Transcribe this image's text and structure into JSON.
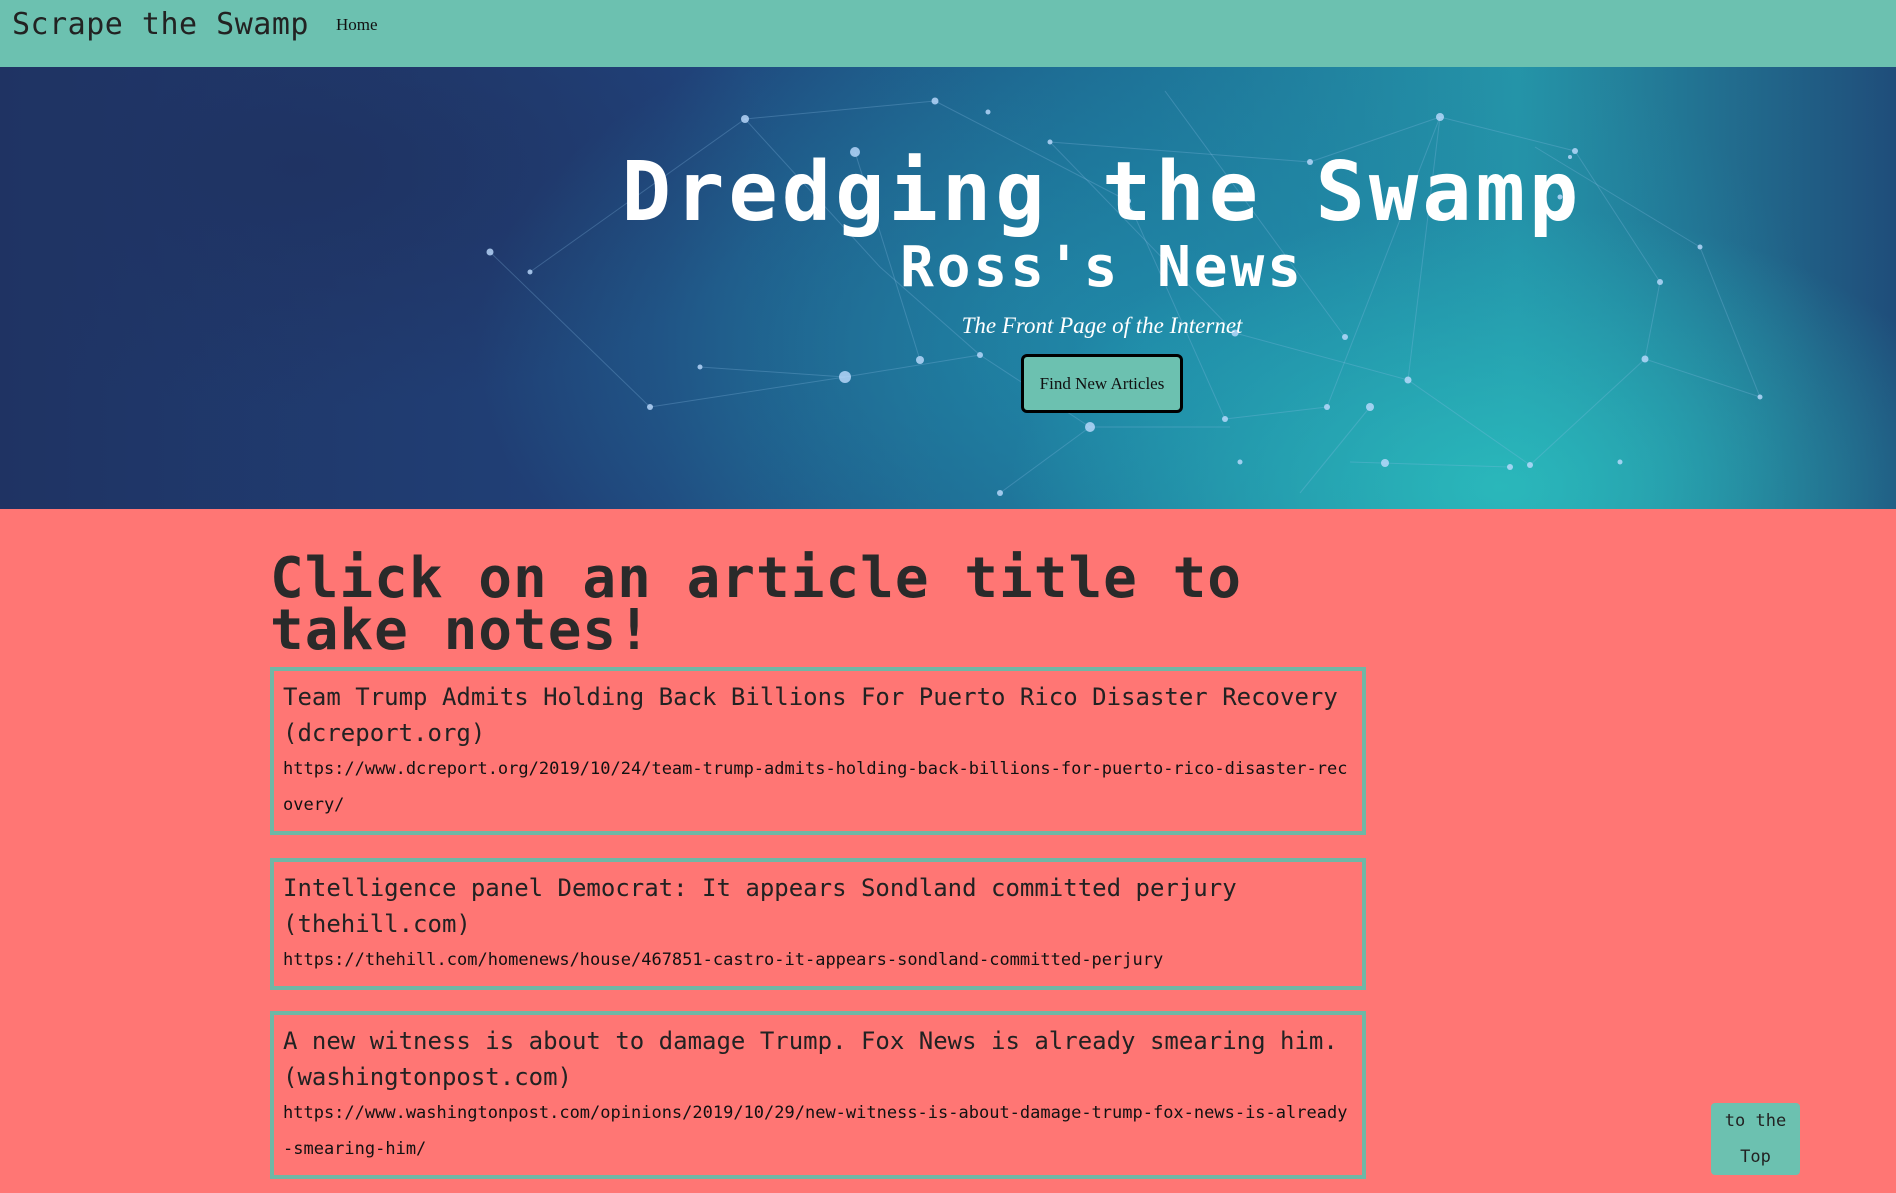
{
  "navbar": {
    "brand": "Scrape the Swamp",
    "home_label": "Home"
  },
  "hero": {
    "title": "Dredging the Swamp",
    "subtitle": "Ross's News",
    "tagline": "The Front Page of the Internet",
    "button_label": "Find New Articles"
  },
  "main": {
    "heading": "Click on an article title to take notes!",
    "articles": [
      {
        "title": "Team Trump Admits Holding Back Billions For Puerto Rico Disaster Recovery (dcreport.org)",
        "url": "https://www.dcreport.org/2019/10/24/team-trump-admits-holding-back-billions-for-puerto-rico-disaster-recovery/"
      },
      {
        "title": "Intelligence panel Democrat: It appears Sondland committed perjury (thehill.com)",
        "url": "https://thehill.com/homenews/house/467851-castro-it-appears-sondland-committed-perjury"
      },
      {
        "title": "A new witness is about to damage Trump. Fox News is already smearing him. (washingtonpost.com)",
        "url": "https://www.washingtonpost.com/opinions/2019/10/29/new-witness-is-about-damage-trump-fox-news-is-already-smearing-him/"
      }
    ]
  },
  "to_top_label": "to the Top",
  "colors": {
    "navbar": "#6cc1b0",
    "page_background": "#ff7674",
    "article_border": "#6fb7a5",
    "button": "#6cc1b0"
  }
}
